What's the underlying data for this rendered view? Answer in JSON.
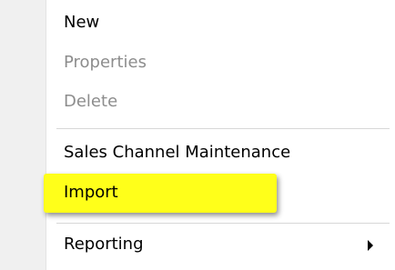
{
  "menu": {
    "items": [
      {
        "label": "New",
        "enabled": true
      },
      {
        "label": "Properties",
        "enabled": false
      },
      {
        "label": "Delete",
        "enabled": false
      },
      {
        "label": "Sales Channel Maintenance",
        "enabled": true
      },
      {
        "label": "Import",
        "enabled": true,
        "highlighted": true
      },
      {
        "label": "Reporting",
        "enabled": true,
        "has_submenu": true
      }
    ],
    "highlight_color": "#ffff1a"
  }
}
